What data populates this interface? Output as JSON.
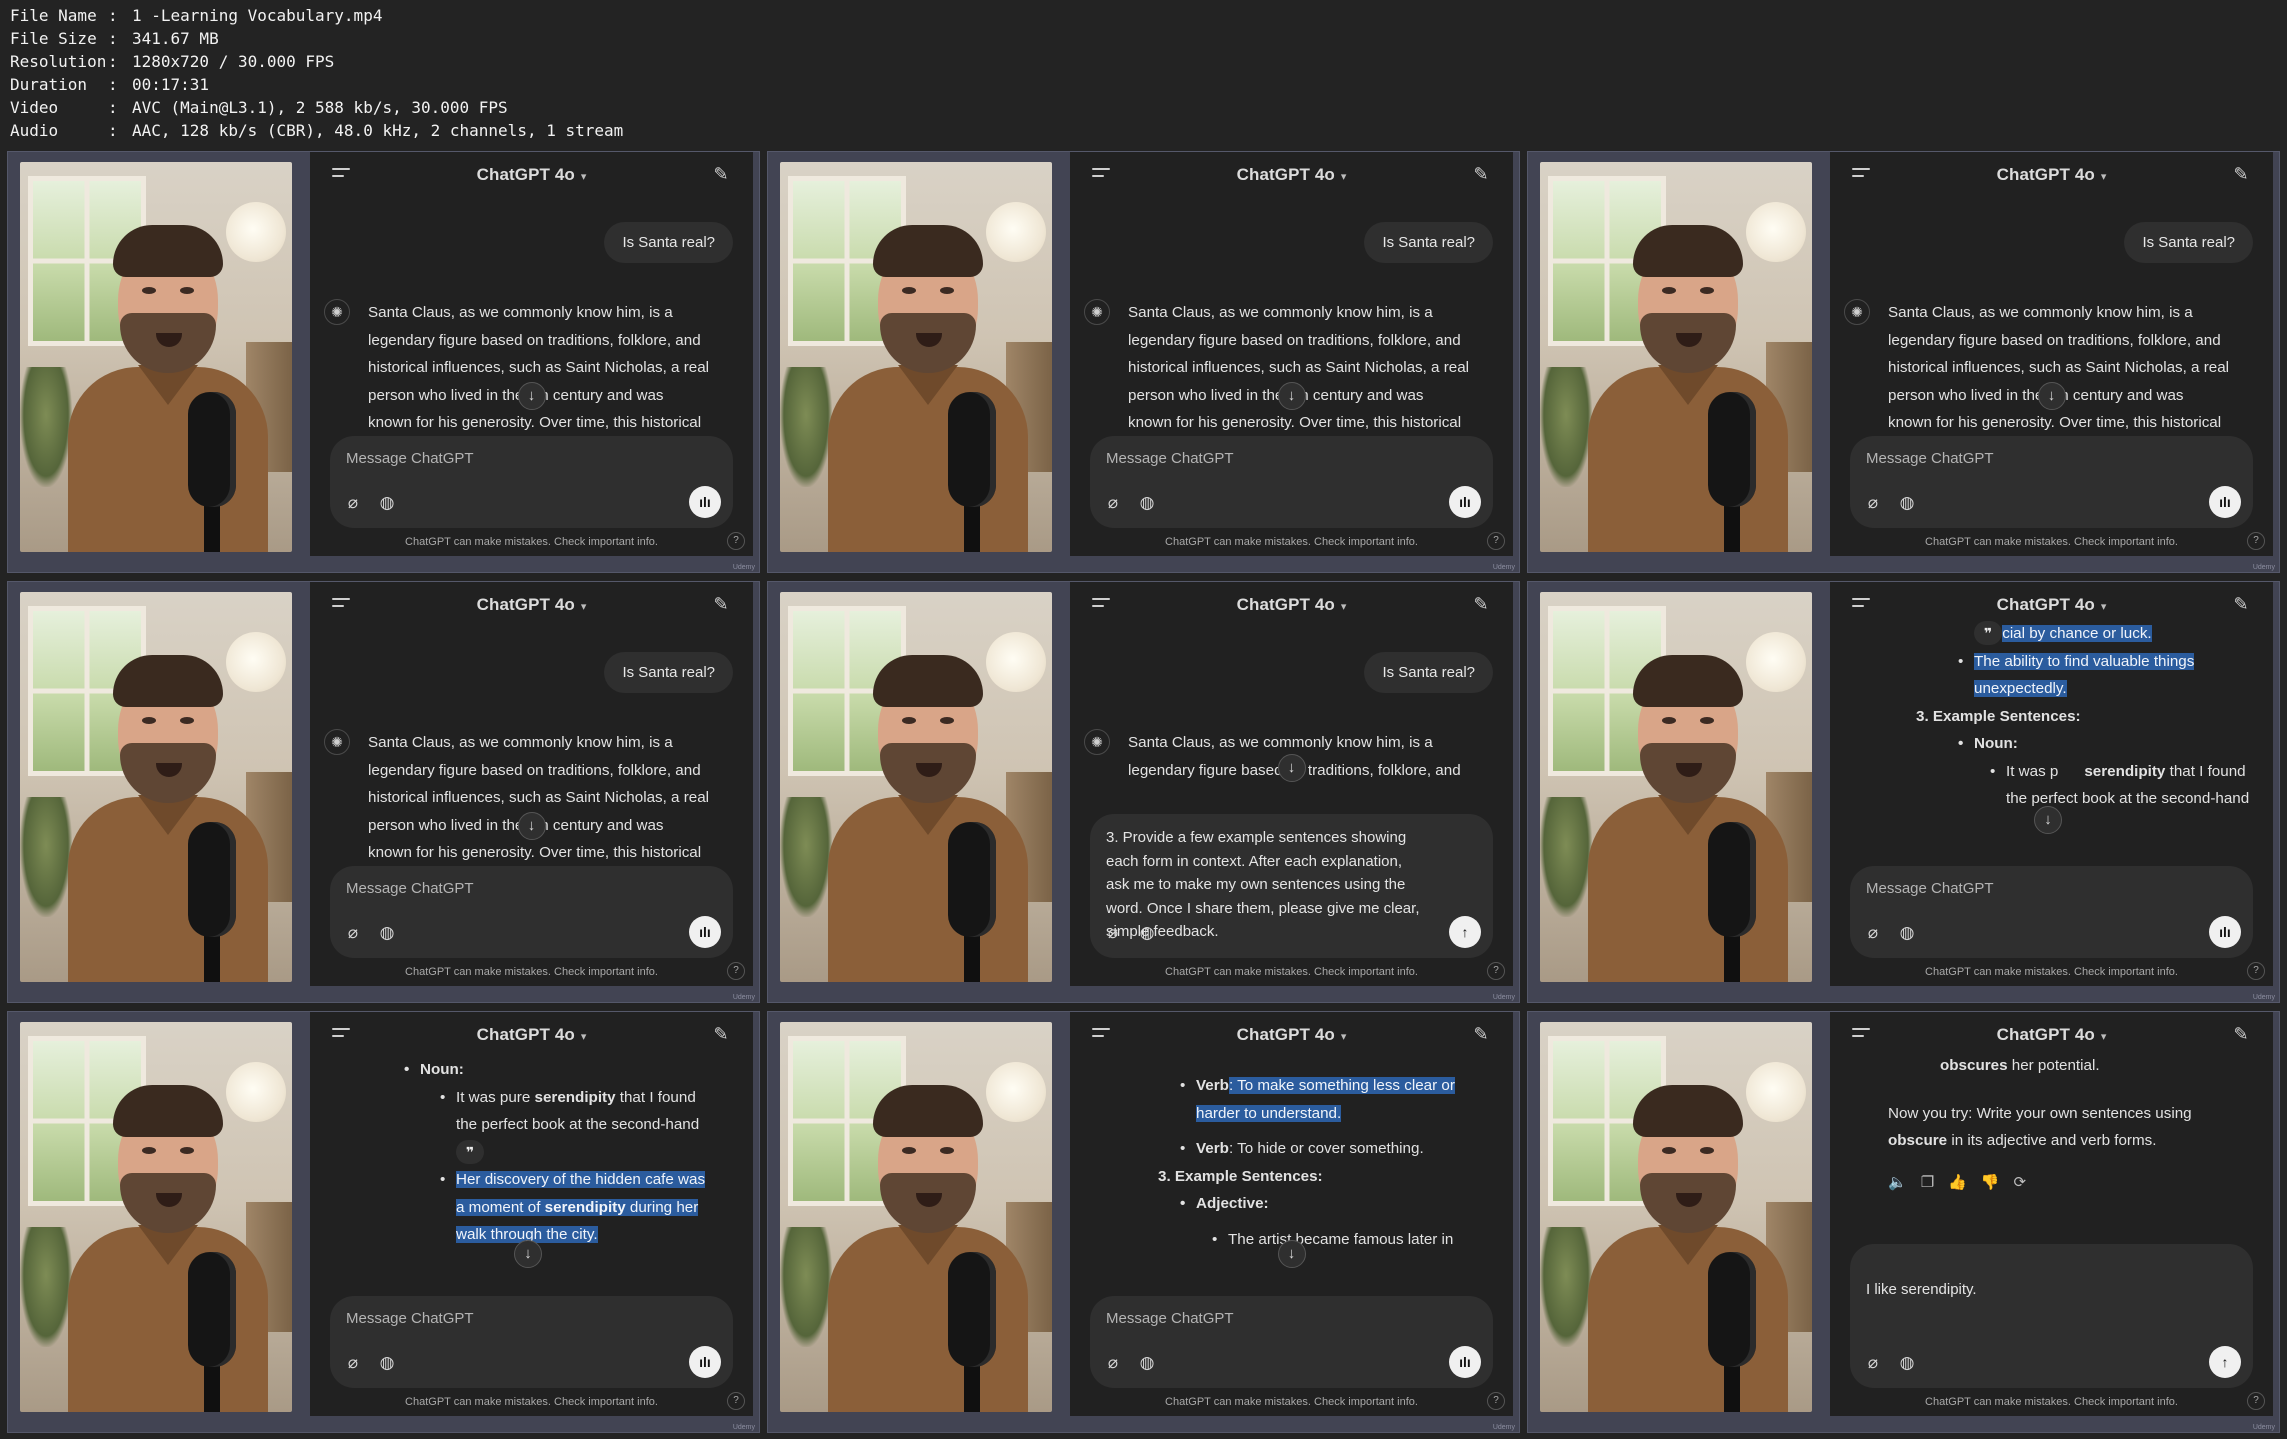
{
  "media_info": [
    {
      "key": "File Name",
      "value": "1 -Learning Vocabulary.mp4"
    },
    {
      "key": "File Size",
      "value": "341.67 MB"
    },
    {
      "key": "Resolution",
      "value": "1280x720 / 30.000 FPS"
    },
    {
      "key": "Duration",
      "value": "00:17:31"
    },
    {
      "key": "Video",
      "value": "AVC (Main@L3.1), 2 588 kb/s, 30.000 FPS"
    },
    {
      "key": "Audio",
      "value": "AAC, 128 kb/s (CBR), 48.0 kHz, 2 channels, 1 stream"
    }
  ],
  "chat": {
    "model": "ChatGPT 4o",
    "placeholder": "Message ChatGPT",
    "footer": "ChatGPT can make mistakes. Check important info.",
    "help": "?",
    "watermark": "Udemy",
    "user_question": "Is Santa real?",
    "answer_lines": [
      "Santa Claus, as we commonly know him, is a",
      "legendary figure based on traditions, folklore, and",
      "historical influences, such as Saint Nicholas, a real",
      "person who lived in the 4th century and was",
      "known for his generosity. Over time, this historical"
    ]
  },
  "frames": {
    "f5": {
      "prompt_lines": [
        "3. Provide a few example sentences showing",
        "each form in context. After each explanation,",
        "ask me to make my own sentences using the",
        "word. Once I share them, please give me clear,",
        "simple feedback."
      ]
    },
    "f6": {
      "l1": "cial by chance or luck.",
      "l2a": "The ability to find valuable things",
      "l2b": "unexpectedly.",
      "l3": "3. Example Sentences:",
      "l4": "Noun:",
      "l5a": "It was p",
      "l5b": "serendipity",
      "l5c": " that I found",
      "l6": "the perfect book at the second-hand"
    },
    "f7": {
      "l1": "Noun:",
      "l2a": "It was pure ",
      "l2b": "serendipity",
      "l2c": " that I found",
      "l3": "the perfect book at the second-hand",
      "l4": "Her discovery of the hidden cafe was",
      "l5a": "a moment of ",
      "l5b": "serendipity",
      "l5c": " during her",
      "l6": "walk through the city."
    },
    "f8": {
      "l1a": "Verb",
      "l1b": ": To make something less clear or",
      "l2": "harder to understand.",
      "l3a": "Verb",
      "l3b": ": To hide or cover something.",
      "l4": "3. Example Sentences:",
      "l5": "Adjective:",
      "l6": "The artist became famous later in"
    },
    "f9": {
      "l1a": "obscures",
      "l1b": " her potential.",
      "l2": "Now you try: Write your own sentences using",
      "l3a": "obscure",
      "l3b": " in its adjective and verb forms.",
      "input": "I like serendipity."
    }
  }
}
